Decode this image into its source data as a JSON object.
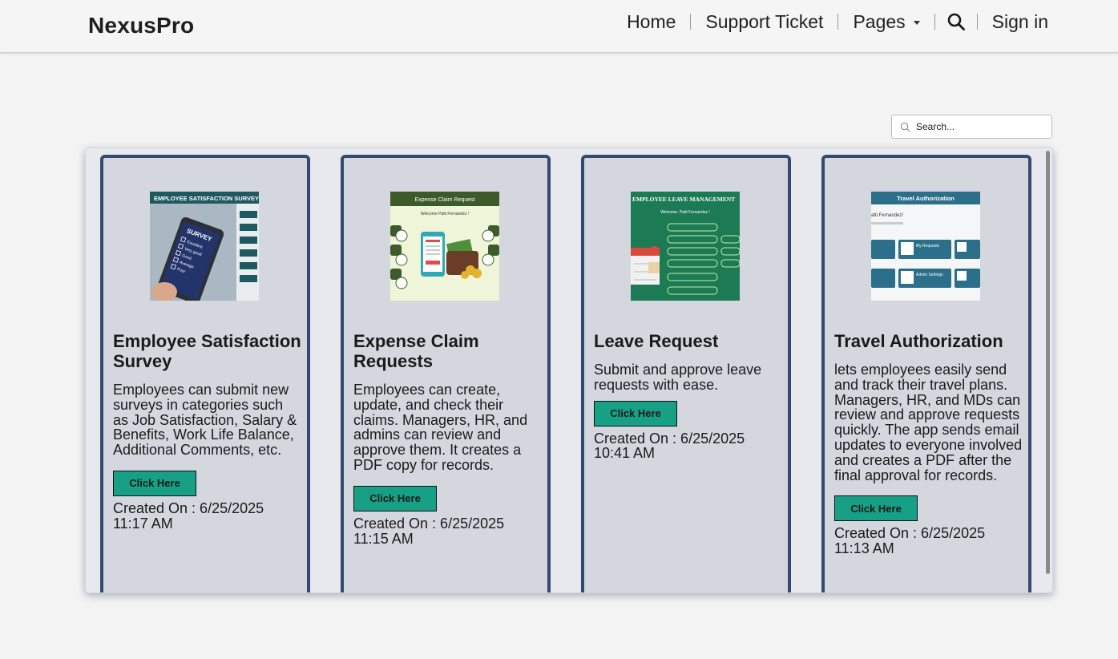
{
  "header": {
    "brand": "NexusPro",
    "nav": {
      "home": "Home",
      "support": "Support Ticket",
      "pages": "Pages",
      "signin": "Sign in"
    }
  },
  "search": {
    "placeholder": "Search..."
  },
  "cards": [
    {
      "title": "Employee Satisfaction Survey",
      "description": "Employees can submit new surveys in categories such as Job Satisfaction, Salary & Benefits, Work Life Balance, Additional Comments, etc.",
      "button": "Click Here",
      "created_label": "Created On : 6/25/2025",
      "created_time": "11:17 AM",
      "thumb_banner": "EMPLOYEE SATISFACTION SURVEY",
      "thumb_words": [
        "SURVEY",
        "Excellent",
        "Very good",
        "Good",
        "Average",
        "Poor"
      ]
    },
    {
      "title": "Expense Claim Requests",
      "description": "Employees can create, update, and check their claims. Managers, HR, and admins can review and approve them. It creates a PDF copy for records.",
      "button": "Click Here",
      "created_label": "Created On : 6/25/2025",
      "created_time": "11:15 AM",
      "thumb_banner": "Expense Claim Request",
      "thumb_sub": "Welcome Patti Fernandez !"
    },
    {
      "title": "Leave Request",
      "description": "Submit and approve leave requests with ease.",
      "button": "Click Here",
      "created_label": "Created On : 6/25/2025",
      "created_time": "10:41 AM",
      "thumb_banner": "EMPLOYEE  LEAVE MANAGEMENT",
      "thumb_sub": "Welcome, Patti Fernandez !"
    },
    {
      "title": "Travel Authorization",
      "description": "lets employees easily send and track their travel plans. Managers, HR, and MDs can review and approve requests quickly. The app sends email updates to everyone involved and creates a PDF after the final approval for records.",
      "button": "Click Here",
      "created_label": "Created On : 6/25/2025",
      "created_time": "11:13 AM",
      "thumb_banner": "Travel Authorization",
      "thumb_sub": "atti Fernandez!",
      "thumb_tiles": [
        "My Requests",
        "Admin Settings"
      ]
    }
  ],
  "colors": {
    "accent_button": "#17a085",
    "card_border": "#344a6e",
    "card_bg": "#d5d7df"
  }
}
